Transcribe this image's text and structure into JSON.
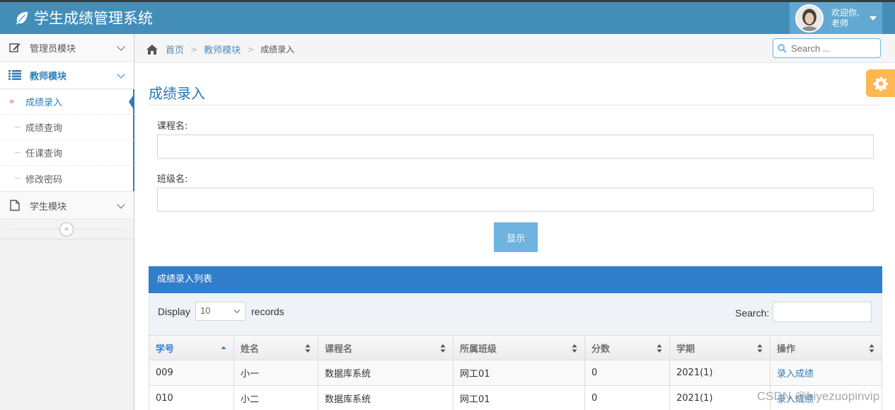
{
  "app": {
    "title": "学生成绩管理系统",
    "welcome_line1": "欢迎你,",
    "welcome_line2": "老师"
  },
  "sidebar": {
    "items": [
      {
        "label": "管理员模块",
        "icon": "edit-icon"
      },
      {
        "label": "教师模块",
        "icon": "list-icon",
        "active": true
      },
      {
        "label": "学生模块",
        "icon": "file-icon"
      }
    ],
    "submenu": [
      {
        "label": "成绩录入",
        "active": true
      },
      {
        "label": "成绩查询"
      },
      {
        "label": "任课查询"
      },
      {
        "label": "修改密码"
      }
    ],
    "collapse_glyph": "«"
  },
  "breadcrumb": {
    "home": "首页",
    "module": "教师模块",
    "current": "成绩录入",
    "separator": ">"
  },
  "header_search": {
    "placeholder": "Search ..."
  },
  "page": {
    "title": "成绩录入",
    "course_label": "课程名:",
    "class_label": "班级名:",
    "show_button": "显示"
  },
  "table_panel": {
    "header": "成绩录入列表",
    "display_label": "Display",
    "page_size": "10",
    "records_label": "records",
    "search_label": "Search:",
    "columns": [
      "学号",
      "姓名",
      "课程名",
      "所属班级",
      "分数",
      "学期",
      "操作"
    ],
    "rows": [
      [
        "009",
        "小一",
        "数据库系统",
        "网工01",
        "0",
        "2021(1)",
        "录入成绩"
      ],
      [
        "010",
        "小二",
        "数据库系统",
        "网工01",
        "0",
        "2021(1)",
        "录入成绩"
      ]
    ]
  },
  "watermark": "CSDN @biyezuopinvip",
  "colors": {
    "navbar": "#438eb9",
    "user_box": "#62a8d1",
    "accent": "#2b7dbc",
    "panel_header": "#307ecc",
    "button": "#6fb3e0",
    "settings_tab": "#ffb752"
  }
}
